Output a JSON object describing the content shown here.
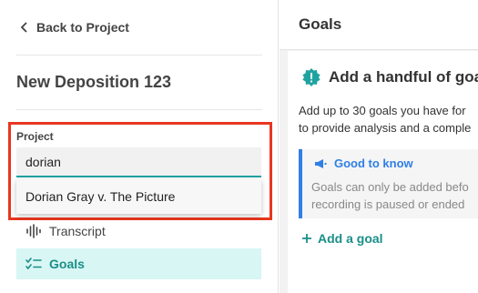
{
  "sidebar": {
    "back_label": "Back to Project",
    "deposition_title": "New Deposition 123",
    "project_label": "Project",
    "project_value": "dorian",
    "dropdown_option": "Dorian Gray v. The Picture",
    "nav": [
      {
        "label": "Transcript",
        "icon": "waveform-icon",
        "active": false
      },
      {
        "label": "Goals",
        "icon": "checklist-icon",
        "active": true
      }
    ]
  },
  "main": {
    "title": "Goals",
    "card": {
      "title": "Add a handful of goa",
      "desc_line1": "Add up to 30 goals you have for",
      "desc_line2": "to provide analysis and a comple",
      "tip_title": "Good to know",
      "tip_line1": "Goals can only be added befo",
      "tip_line2": "recording is paused or ended",
      "add_goal": "Add a goal"
    }
  },
  "colors": {
    "accent": "#1a8f88",
    "highlight": "#e8361f",
    "info": "#2f7fe6"
  }
}
